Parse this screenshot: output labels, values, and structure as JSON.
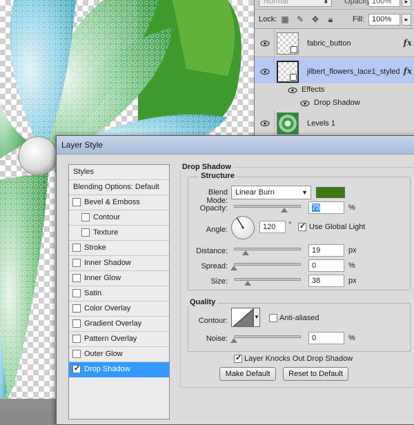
{
  "layers_panel": {
    "blend_mode": "Normal",
    "opacity_label": "Opacity:",
    "opacity_value": "100%",
    "lock_label": "Lock:",
    "fill_label": "Fill:",
    "fill_value": "100%",
    "layers": [
      {
        "name": "fabric_button",
        "fx": "fx"
      },
      {
        "name": "jilbert_flowers_lace1_styled",
        "fx": "fx"
      },
      {
        "name": "Levels 1"
      }
    ],
    "effects_label": "Effects",
    "effect_items": [
      "Drop Shadow"
    ]
  },
  "dialog": {
    "title": "Layer Style",
    "styles_list": {
      "header": "Styles",
      "blending_options": "Blending Options: Default",
      "items": [
        {
          "label": "Bevel & Emboss",
          "checked": false,
          "indent": false
        },
        {
          "label": "Contour",
          "checked": false,
          "indent": true
        },
        {
          "label": "Texture",
          "checked": false,
          "indent": true
        },
        {
          "label": "Stroke",
          "checked": false,
          "indent": false
        },
        {
          "label": "Inner Shadow",
          "checked": false,
          "indent": false
        },
        {
          "label": "Inner Glow",
          "checked": false,
          "indent": false
        },
        {
          "label": "Satin",
          "checked": false,
          "indent": false
        },
        {
          "label": "Color Overlay",
          "checked": false,
          "indent": false
        },
        {
          "label": "Gradient Overlay",
          "checked": false,
          "indent": false
        },
        {
          "label": "Pattern Overlay",
          "checked": false,
          "indent": false
        },
        {
          "label": "Outer Glow",
          "checked": false,
          "indent": false
        },
        {
          "label": "Drop Shadow",
          "checked": true,
          "indent": false,
          "active": true
        }
      ]
    },
    "drop_shadow": {
      "section_title": "Drop Shadow",
      "structure_title": "Structure",
      "blend_mode_label": "Blend Mode:",
      "blend_mode_value": "Linear Burn",
      "shadow_color": "#3e7a12",
      "opacity_label": "Opacity:",
      "opacity_value": "75",
      "opacity_unit": "%",
      "opacity_fraction": 0.75,
      "angle_label": "Angle:",
      "angle_value": "120",
      "angle_unit": "°",
      "use_global_light_label": "Use Global Light",
      "use_global_light": true,
      "distance_label": "Distance:",
      "distance_value": "19",
      "distance_unit": "px",
      "spread_label": "Spread:",
      "spread_value": "0",
      "spread_unit": "%",
      "size_label": "Size:",
      "size_value": "38",
      "size_unit": "px",
      "quality_title": "Quality",
      "contour_label": "Contour:",
      "anti_aliased_label": "Anti-aliased",
      "anti_aliased": false,
      "noise_label": "Noise:",
      "noise_value": "0",
      "noise_unit": "%",
      "layer_knocks_out_label": "Layer Knocks Out Drop Shadow",
      "layer_knocks_out": true,
      "make_default_label": "Make Default",
      "reset_default_label": "Reset to Default"
    }
  },
  "colors": {
    "accent_selection": "#3399ff",
    "selected_layer_bg": "#b6c9f5"
  }
}
